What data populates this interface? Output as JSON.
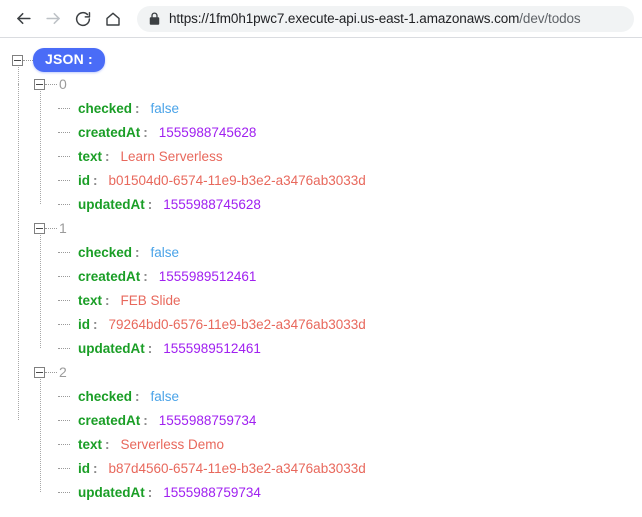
{
  "browser": {
    "back_icon": "back-arrow-icon",
    "forward_icon": "forward-arrow-icon",
    "reload_icon": "reload-icon",
    "home_icon": "home-icon",
    "lock_icon": "lock-icon",
    "url_domain": "https://1fm0h1pwc7.execute-api.us-east-1.amazonaws.com",
    "url_path": "/dev/todos",
    "url_full": "https://1fm0h1pwc7.execute-api.us-east-1.amazonaws.com/dev/todos"
  },
  "viewer": {
    "root_label": "JSON :",
    "colon": ":",
    "colors": {
      "badge_bg": "#4a6cf7",
      "key": "#1a9e26",
      "boolean": "#4aa3e8",
      "number": "#a020f0",
      "string": "#e8685c",
      "index": "#9b9b9b"
    }
  },
  "records": [
    {
      "index": "0",
      "fields": [
        {
          "key": "checked",
          "value": "false",
          "type": "boolean"
        },
        {
          "key": "createdAt",
          "value": "1555988745628",
          "type": "number"
        },
        {
          "key": "text",
          "value": "Learn Serverless",
          "type": "string"
        },
        {
          "key": "id",
          "value": "b01504d0-6574-11e9-b3e2-a3476ab3033d",
          "type": "string"
        },
        {
          "key": "updatedAt",
          "value": "1555988745628",
          "type": "number"
        }
      ]
    },
    {
      "index": "1",
      "fields": [
        {
          "key": "checked",
          "value": "false",
          "type": "boolean"
        },
        {
          "key": "createdAt",
          "value": "1555989512461",
          "type": "number"
        },
        {
          "key": "text",
          "value": "FEB Slide",
          "type": "string"
        },
        {
          "key": "id",
          "value": "79264bd0-6576-11e9-b3e2-a3476ab3033d",
          "type": "string"
        },
        {
          "key": "updatedAt",
          "value": "1555989512461",
          "type": "number"
        }
      ]
    },
    {
      "index": "2",
      "fields": [
        {
          "key": "checked",
          "value": "false",
          "type": "boolean"
        },
        {
          "key": "createdAt",
          "value": "1555988759734",
          "type": "number"
        },
        {
          "key": "text",
          "value": "Serverless Demo",
          "type": "string"
        },
        {
          "key": "id",
          "value": "b87d4560-6574-11e9-b3e2-a3476ab3033d",
          "type": "string"
        },
        {
          "key": "updatedAt",
          "value": "1555988759734",
          "type": "number"
        }
      ]
    }
  ]
}
